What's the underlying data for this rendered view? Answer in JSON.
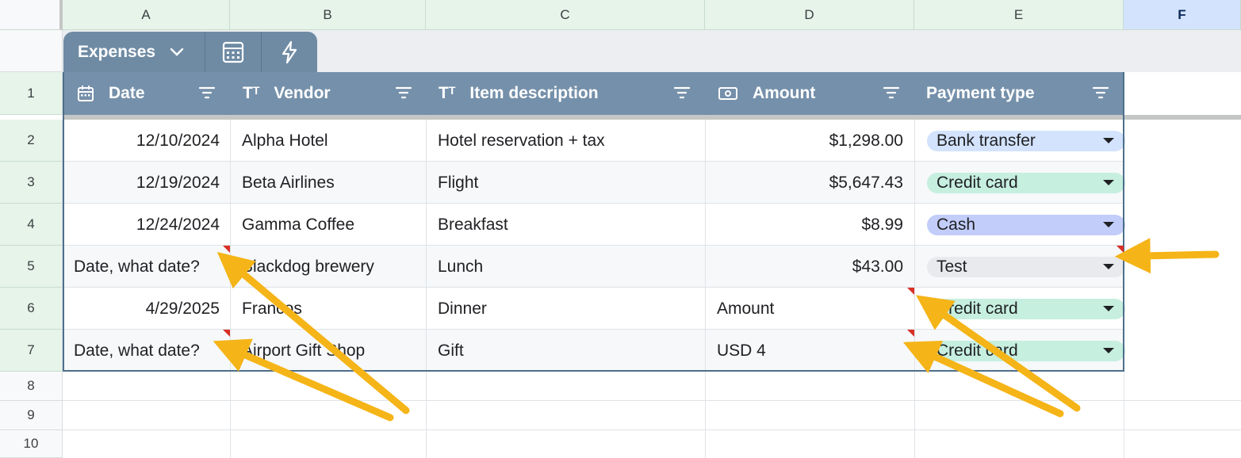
{
  "columns": [
    "A",
    "B",
    "C",
    "D",
    "E",
    "F"
  ],
  "rows": [
    "1",
    "2",
    "3",
    "4",
    "5",
    "6",
    "7",
    "8",
    "9",
    "10"
  ],
  "table": {
    "name": "Expenses",
    "headers": {
      "date": "Date",
      "vendor": "Vendor",
      "item": "Item description",
      "amount": "Amount",
      "payment": "Payment type"
    },
    "data": [
      {
        "date": "12/10/2024",
        "vendor": "Alpha Hotel",
        "item": "Hotel reservation + tax",
        "amount": "$1,298.00",
        "payment": "Bank transfer"
      },
      {
        "date": "12/19/2024",
        "vendor": "Beta Airlines",
        "item": "Flight",
        "amount": "$5,647.43",
        "payment": "Credit card"
      },
      {
        "date": "12/24/2024",
        "vendor": "Gamma Coffee",
        "item": "Breakfast",
        "amount": "$8.99",
        "payment": "Cash"
      },
      {
        "date": "Date, what date?",
        "vendor": "Blackdog brewery",
        "item": "Lunch",
        "amount": "$43.00",
        "payment": "Test"
      },
      {
        "date": "4/29/2025",
        "vendor": "Francos",
        "item": "Dinner",
        "amount": "Amount",
        "payment": "Credit card"
      },
      {
        "date": "Date, what date?",
        "vendor": "Airport Gift Shop",
        "item": "Gift",
        "amount": "USD 4",
        "payment": "Credit card"
      }
    ]
  },
  "chip_colors": {
    "Bank transfer": "#d3e3fd",
    "Credit card": "#c6efe0",
    "Cash": "#c2cdfa",
    "Test": "#e8eaed"
  },
  "colors": {
    "header_bg": "#7590aa",
    "toolbar_tab": "#6f8ba4",
    "annotation_arrow": "#f5b417",
    "note_marker": "#d93025"
  },
  "icons": {
    "date": "calendar-icon",
    "vendor": "text-type-icon",
    "item": "text-type-icon",
    "amount": "money-icon",
    "tab_dropdown": "chevron-down-icon",
    "calc": "calculator-icon",
    "bolt": "lightning-icon",
    "filter": "filter-icon"
  }
}
